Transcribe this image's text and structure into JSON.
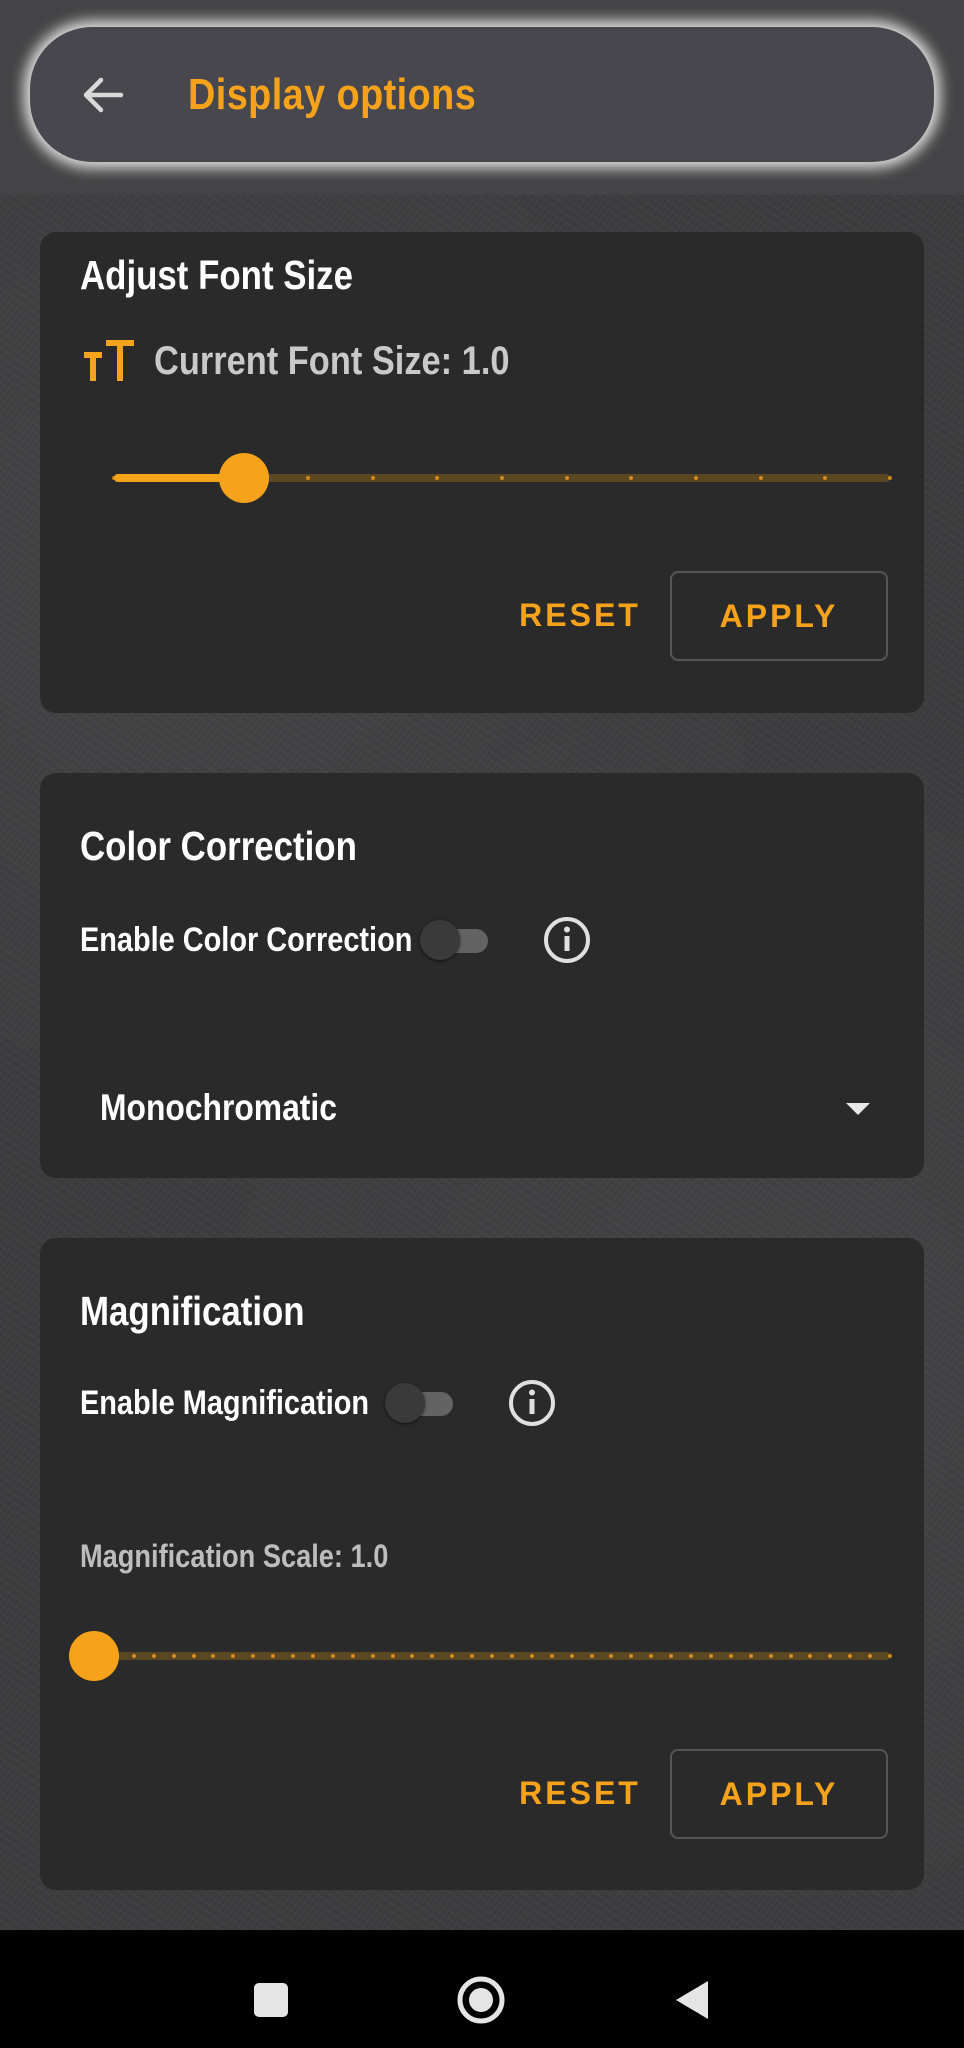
{
  "app": {
    "title": "Display options"
  },
  "font_size": {
    "title": "Adjust Font Size",
    "current_label": "Current Font Size: 1.0",
    "slider_value_fraction": 0.167,
    "reset_label": "RESET",
    "apply_label": "APPLY"
  },
  "color_correction": {
    "title": "Color Correction",
    "toggle_label": "Enable Color Correction",
    "enabled": false,
    "mode_value": "Monochromatic"
  },
  "magnification": {
    "title": "Magnification",
    "toggle_label": "Enable Magnification",
    "enabled": false,
    "scale_label": "Magnification Scale: 1.0",
    "slider_value_fraction": 0.0,
    "reset_label": "RESET",
    "apply_label": "APPLY"
  },
  "colors": {
    "accent": "#f7a21b",
    "card": "#2a2a2a",
    "app_bar": "#48474d"
  },
  "icons": {
    "back": "arrow-left-icon",
    "font_size": "text-size-icon",
    "info": "info-icon",
    "dropdown": "caret-down-icon",
    "nav_recents": "square-icon",
    "nav_home": "circle-icon",
    "nav_back": "triangle-left-icon"
  }
}
